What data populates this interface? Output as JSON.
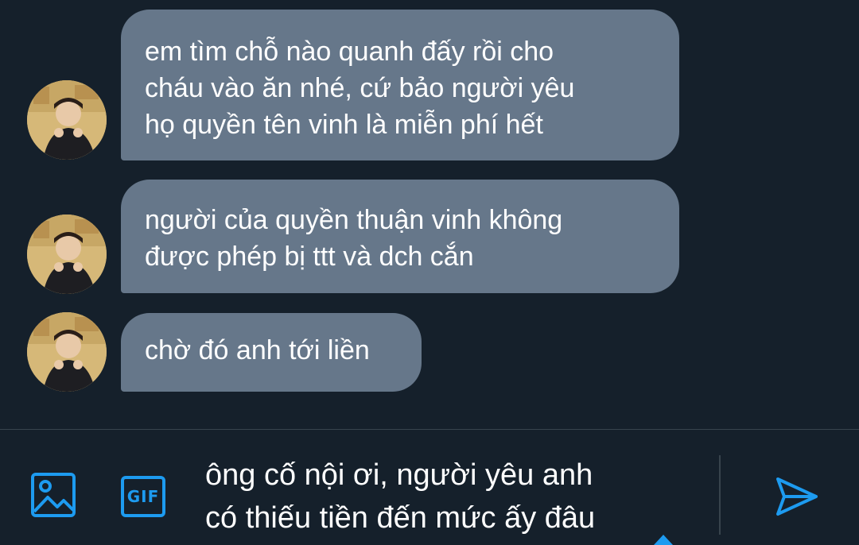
{
  "messages": [
    {
      "text": "em tìm chỗ nào quanh đấy rồi cho\ncháu vào ăn nhé, cứ bảo người yêu\nhọ quyền tên vinh là miễn phí hết"
    },
    {
      "text": "người của quyền thuận vinh không\nđược phép bị ttt và dch cắn"
    },
    {
      "text": "chờ đó anh tới liền"
    }
  ],
  "composer": {
    "gif_label": "GIF",
    "draft": "ông cố nội ơi, người yêu anh\ncó thiếu tiền đến mức ấy đâu"
  },
  "colors": {
    "background": "#15202b",
    "bubble": "#66778a",
    "accent": "#1d9bf0"
  },
  "icons": [
    "image-icon",
    "gif-icon",
    "send-icon"
  ]
}
